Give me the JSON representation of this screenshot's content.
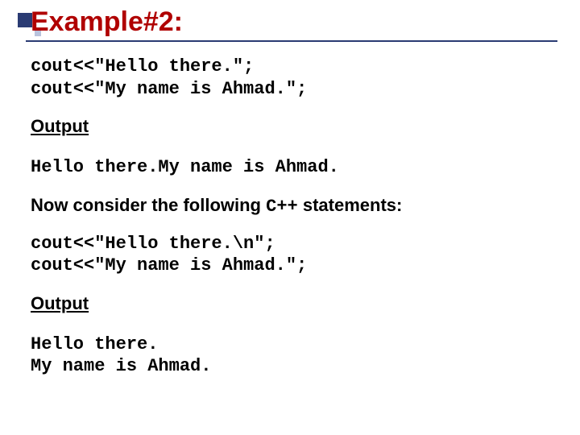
{
  "title": "Example#2:",
  "code1": "cout<<\"Hello there.\";\ncout<<\"My name is Ahmad.\";",
  "outputLabel1": "Output",
  "result1": "Hello there.My name is Ahmad.",
  "narrative_pre": "Now consider the following ",
  "narrative_mono": "C++",
  "narrative_post": " statements:",
  "code2": "cout<<\"Hello there.\\n\";\ncout<<\"My name is Ahmad.\";",
  "outputLabel2": "Output",
  "result2": "Hello there.\nMy name is Ahmad."
}
